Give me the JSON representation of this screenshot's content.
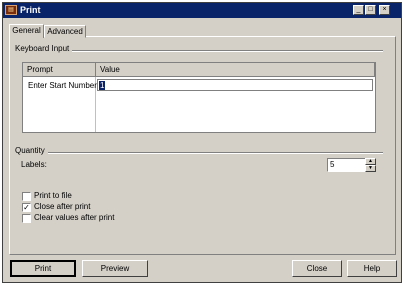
{
  "window": {
    "title": "Print",
    "app_icon": "label-printer-icon",
    "controls": {
      "minimize": "_",
      "maximize": "□",
      "close": "×"
    }
  },
  "tabs": [
    {
      "label": "General",
      "selected": true
    },
    {
      "label": "Advanced",
      "selected": false
    }
  ],
  "keyboard_input": {
    "group_label": "Keyboard Input",
    "columns": [
      "Prompt",
      "Value"
    ],
    "rows": [
      {
        "prompt": "Enter Start Number",
        "value": "1"
      }
    ]
  },
  "quantity": {
    "group_label": "Quantity",
    "labels_label": "Labels:",
    "labels_value": "5"
  },
  "options": [
    {
      "label": "Print to file",
      "checked": false
    },
    {
      "label": "Close after print",
      "checked": true
    },
    {
      "label": "Clear values after print",
      "checked": false
    }
  ],
  "buttons": {
    "print": "Print",
    "preview": "Preview",
    "close": "Close",
    "help": "Help"
  }
}
